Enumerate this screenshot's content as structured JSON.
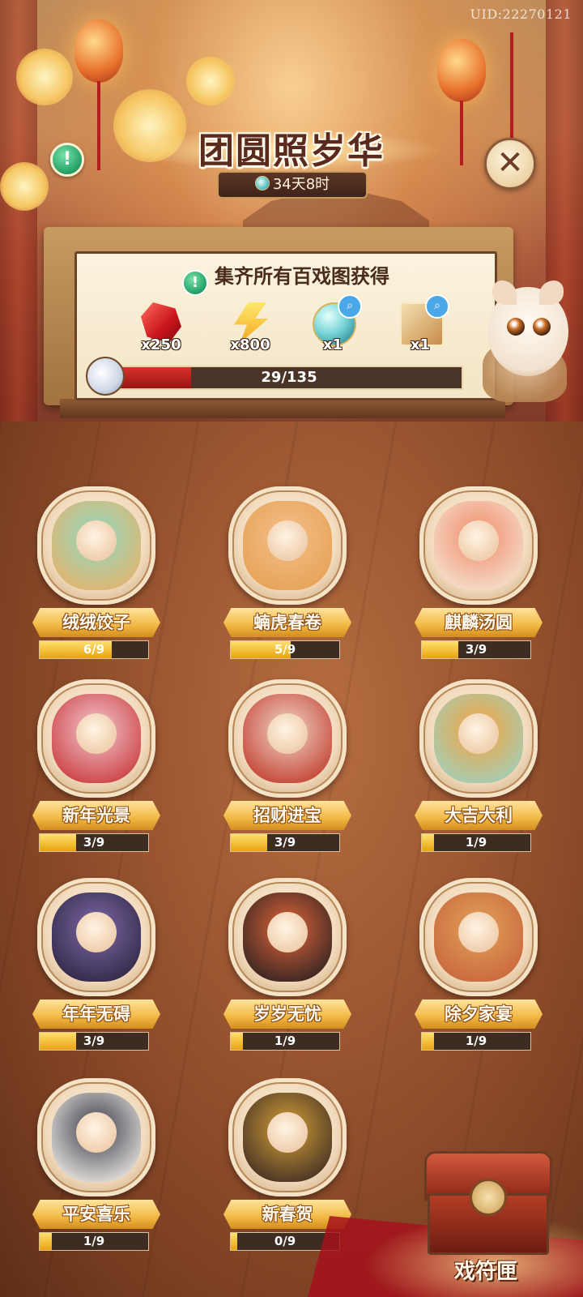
{
  "uid": "UID:22270121",
  "header": {
    "title": "团圆照岁华",
    "timer": "34天8时"
  },
  "reward_panel": {
    "heading": "集齐所有百戏图获得",
    "rewards": [
      {
        "icon": "ruby-gem-icon",
        "qty": "x250"
      },
      {
        "icon": "lightning-energy-icon",
        "qty": "x800"
      },
      {
        "icon": "jade-orb-icon",
        "qty": "x1"
      },
      {
        "icon": "lion-dance-card-icon",
        "qty": "x1"
      }
    ],
    "progress": {
      "current": 29,
      "total": 135,
      "label": "29/135"
    }
  },
  "items": [
    {
      "name": "绒绒饺子",
      "progress": "6/9",
      "count": 6,
      "total": 9
    },
    {
      "name": "蝻虎春卷",
      "progress": "5/9",
      "count": 5,
      "total": 9
    },
    {
      "name": "麒麟汤圆",
      "progress": "3/9",
      "count": 3,
      "total": 9
    },
    {
      "name": "新年光景",
      "progress": "3/9",
      "count": 3,
      "total": 9
    },
    {
      "name": "招财进宝",
      "progress": "3/9",
      "count": 3,
      "total": 9
    },
    {
      "name": "大吉大利",
      "progress": "1/9",
      "count": 1,
      "total": 9
    },
    {
      "name": "年年无碍",
      "progress": "3/9",
      "count": 3,
      "total": 9
    },
    {
      "name": "岁岁无忧",
      "progress": "1/9",
      "count": 1,
      "total": 9
    },
    {
      "name": "除夕家宴",
      "progress": "1/9",
      "count": 1,
      "total": 9
    },
    {
      "name": "平安喜乐",
      "progress": "1/9",
      "count": 1,
      "total": 9
    },
    {
      "name": "新春贺",
      "progress": "0/9",
      "count": 0,
      "total": 9
    }
  ],
  "chest": {
    "label": "戏符匣"
  },
  "colors": {
    "accent_gold": "#f1b944",
    "progress_red": "#d6322c",
    "panel_bg": "#fbf3df"
  }
}
